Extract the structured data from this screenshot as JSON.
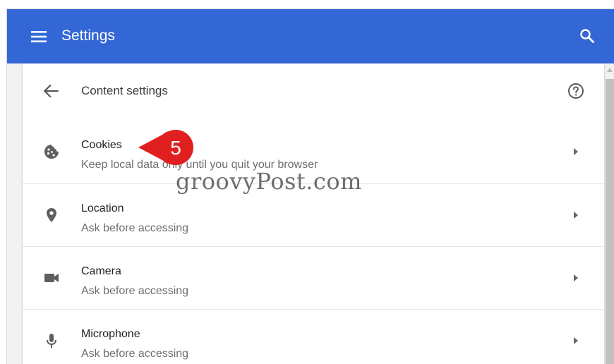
{
  "topbar": {
    "title": "Settings",
    "menu_icon": "hamburger-menu-icon",
    "search_icon": "search-icon",
    "background": "#3367d6"
  },
  "header": {
    "title": "Content settings",
    "back_icon": "back-arrow-icon",
    "help_icon": "help-circle-icon"
  },
  "items": [
    {
      "title": "Cookies",
      "subtitle": "Keep local data only until you quit your browser",
      "icon": "cookie-icon"
    },
    {
      "title": "Location",
      "subtitle": "Ask before accessing",
      "icon": "location-pin-icon"
    },
    {
      "title": "Camera",
      "subtitle": "Ask before accessing",
      "icon": "camera-icon"
    },
    {
      "title": "Microphone",
      "subtitle": "Ask before accessing",
      "icon": "microphone-icon"
    }
  ],
  "annotation": {
    "step_number": "5",
    "color": "#e0201f"
  },
  "watermark": "groovyPost.com"
}
